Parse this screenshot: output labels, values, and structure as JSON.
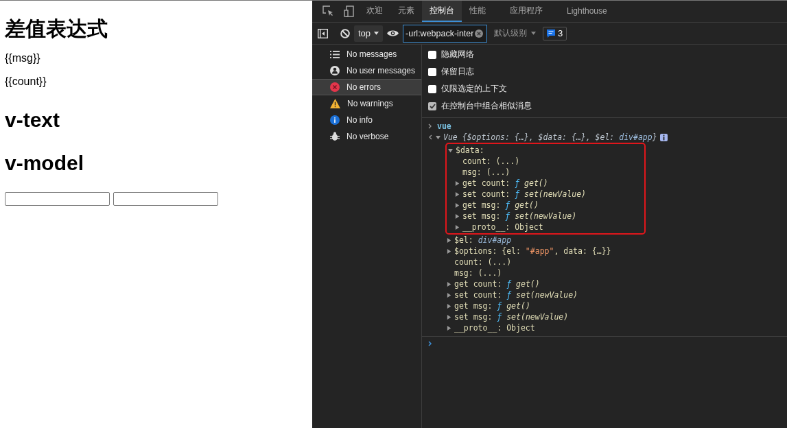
{
  "page": {
    "heading": "差值表达式",
    "lines": [
      "{{msg}}",
      "{{count}}"
    ],
    "sections": [
      "v-text",
      "v-model"
    ],
    "inputs": [
      {
        "value_shown": false
      },
      {
        "value_shown": false
      }
    ]
  },
  "devtools": {
    "tabs": [
      {
        "label": "欢迎",
        "selected": false
      },
      {
        "label": "元素",
        "selected": false
      },
      {
        "label": "控制台",
        "selected": true
      },
      {
        "label": "性能",
        "selected": false
      },
      {
        "label": "应用程序",
        "selected": false
      },
      {
        "label": "Lighthouse",
        "selected": false
      }
    ],
    "toolbar": {
      "context": "top",
      "filter": {
        "value": "-url:webpack-inter"
      },
      "level": "默认级别",
      "issues": "3"
    },
    "sidebar": [
      {
        "label": "No messages",
        "selected": false
      },
      {
        "label": "No user messages",
        "selected": false
      },
      {
        "label": "No errors",
        "selected": true
      },
      {
        "label": "No warnings",
        "selected": false
      },
      {
        "label": "No info",
        "selected": false
      },
      {
        "label": "No verbose",
        "selected": false
      }
    ],
    "settings": [
      {
        "label": "隐藏网络",
        "checked": false
      },
      {
        "label": "保留日志",
        "checked": false
      },
      {
        "label": "仅限选定的上下文",
        "checked": false
      },
      {
        "label": "在控制台中组合相似消息",
        "checked": true
      }
    ],
    "console": {
      "input": "vue",
      "result": {
        "expanded": true,
        "summary": [
          {
            "text": "Vue {",
            "kind": "preview"
          },
          {
            "text": "$options",
            "kind": "preview"
          },
          {
            "text": ": {…}, ",
            "kind": "preview"
          },
          {
            "text": "$data",
            "kind": "preview"
          },
          {
            "text": ": {…}, ",
            "kind": "preview"
          },
          {
            "text": "$el",
            "kind": "preview"
          },
          {
            "text": ": ",
            "kind": "preview"
          },
          {
            "text": "div#app",
            "kind": "node"
          },
          {
            "text": "}",
            "kind": "preview"
          }
        ],
        "children": [
          {
            "kind": "branch",
            "expanded": true,
            "highlighted": true,
            "segments": [
              {
                "text": "$data",
                "kind": "name"
              },
              {
                "text": ":",
                "kind": "punct"
              }
            ],
            "children": [
              {
                "kind": "leaf",
                "segments": [
                  {
                    "text": "count",
                    "kind": "name"
                  },
                  {
                    "text": ": (...)",
                    "kind": "punct"
                  }
                ]
              },
              {
                "kind": "leaf",
                "segments": [
                  {
                    "text": "msg",
                    "kind": "name"
                  },
                  {
                    "text": ": (...)",
                    "kind": "punct"
                  }
                ]
              },
              {
                "kind": "branch",
                "expanded": false,
                "segments": [
                  {
                    "text": "get count",
                    "kind": "name"
                  },
                  {
                    "text": ": ",
                    "kind": "punct"
                  },
                  {
                    "text": "ƒ",
                    "kind": "func"
                  },
                  {
                    "text": " get()",
                    "kind": "sig"
                  }
                ]
              },
              {
                "kind": "branch",
                "expanded": false,
                "segments": [
                  {
                    "text": "set count",
                    "kind": "name"
                  },
                  {
                    "text": ": ",
                    "kind": "punct"
                  },
                  {
                    "text": "ƒ",
                    "kind": "func"
                  },
                  {
                    "text": " set(newValue)",
                    "kind": "sig"
                  }
                ]
              },
              {
                "kind": "branch",
                "expanded": false,
                "segments": [
                  {
                    "text": "get msg",
                    "kind": "name"
                  },
                  {
                    "text": ": ",
                    "kind": "punct"
                  },
                  {
                    "text": "ƒ",
                    "kind": "func"
                  },
                  {
                    "text": " get()",
                    "kind": "sig"
                  }
                ]
              },
              {
                "kind": "branch",
                "expanded": false,
                "segments": [
                  {
                    "text": "set msg",
                    "kind": "name"
                  },
                  {
                    "text": ": ",
                    "kind": "punct"
                  },
                  {
                    "text": "ƒ",
                    "kind": "func"
                  },
                  {
                    "text": " set(newValue)",
                    "kind": "sig"
                  }
                ]
              },
              {
                "kind": "branch",
                "expanded": false,
                "segments": [
                  {
                    "text": "__proto__",
                    "kind": "name"
                  },
                  {
                    "text": ": Object",
                    "kind": "punct"
                  }
                ]
              }
            ]
          },
          {
            "kind": "branch",
            "expanded": false,
            "highlighted": false,
            "segments": [
              {
                "text": "$el",
                "kind": "name"
              },
              {
                "text": ": ",
                "kind": "punct"
              },
              {
                "text": "div#app",
                "kind": "node"
              }
            ]
          },
          {
            "kind": "branch",
            "expanded": false,
            "highlighted": false,
            "segments": [
              {
                "text": "$options",
                "kind": "name"
              },
              {
                "text": ": {el: ",
                "kind": "punct"
              },
              {
                "text": "\"#app\"",
                "kind": "string"
              },
              {
                "text": ", data: {…}}",
                "kind": "punct"
              }
            ]
          },
          {
            "kind": "leaf",
            "segments": [
              {
                "text": "count",
                "kind": "name"
              },
              {
                "text": ": (...)",
                "kind": "punct"
              }
            ]
          },
          {
            "kind": "leaf",
            "segments": [
              {
                "text": "msg",
                "kind": "name"
              },
              {
                "text": ": (...)",
                "kind": "punct"
              }
            ]
          },
          {
            "kind": "branch",
            "expanded": false,
            "highlighted": false,
            "segments": [
              {
                "text": "get count",
                "kind": "name"
              },
              {
                "text": ": ",
                "kind": "punct"
              },
              {
                "text": "ƒ",
                "kind": "func"
              },
              {
                "text": " get()",
                "kind": "sig"
              }
            ]
          },
          {
            "kind": "branch",
            "expanded": false,
            "highlighted": false,
            "segments": [
              {
                "text": "set count",
                "kind": "name"
              },
              {
                "text": ": ",
                "kind": "punct"
              },
              {
                "text": "ƒ",
                "kind": "func"
              },
              {
                "text": " set(newValue)",
                "kind": "sig"
              }
            ]
          },
          {
            "kind": "branch",
            "expanded": false,
            "highlighted": false,
            "segments": [
              {
                "text": "get msg",
                "kind": "name"
              },
              {
                "text": ": ",
                "kind": "punct"
              },
              {
                "text": "ƒ",
                "kind": "func"
              },
              {
                "text": " get()",
                "kind": "sig"
              }
            ]
          },
          {
            "kind": "branch",
            "expanded": false,
            "highlighted": false,
            "segments": [
              {
                "text": "set msg",
                "kind": "name"
              },
              {
                "text": ": ",
                "kind": "punct"
              },
              {
                "text": "ƒ",
                "kind": "func"
              },
              {
                "text": " set(newValue)",
                "kind": "sig"
              }
            ]
          },
          {
            "kind": "branch",
            "expanded": false,
            "highlighted": false,
            "segments": [
              {
                "text": "__proto__",
                "kind": "name"
              },
              {
                "text": ": Object",
                "kind": "punct"
              }
            ]
          }
        ]
      }
    }
  }
}
